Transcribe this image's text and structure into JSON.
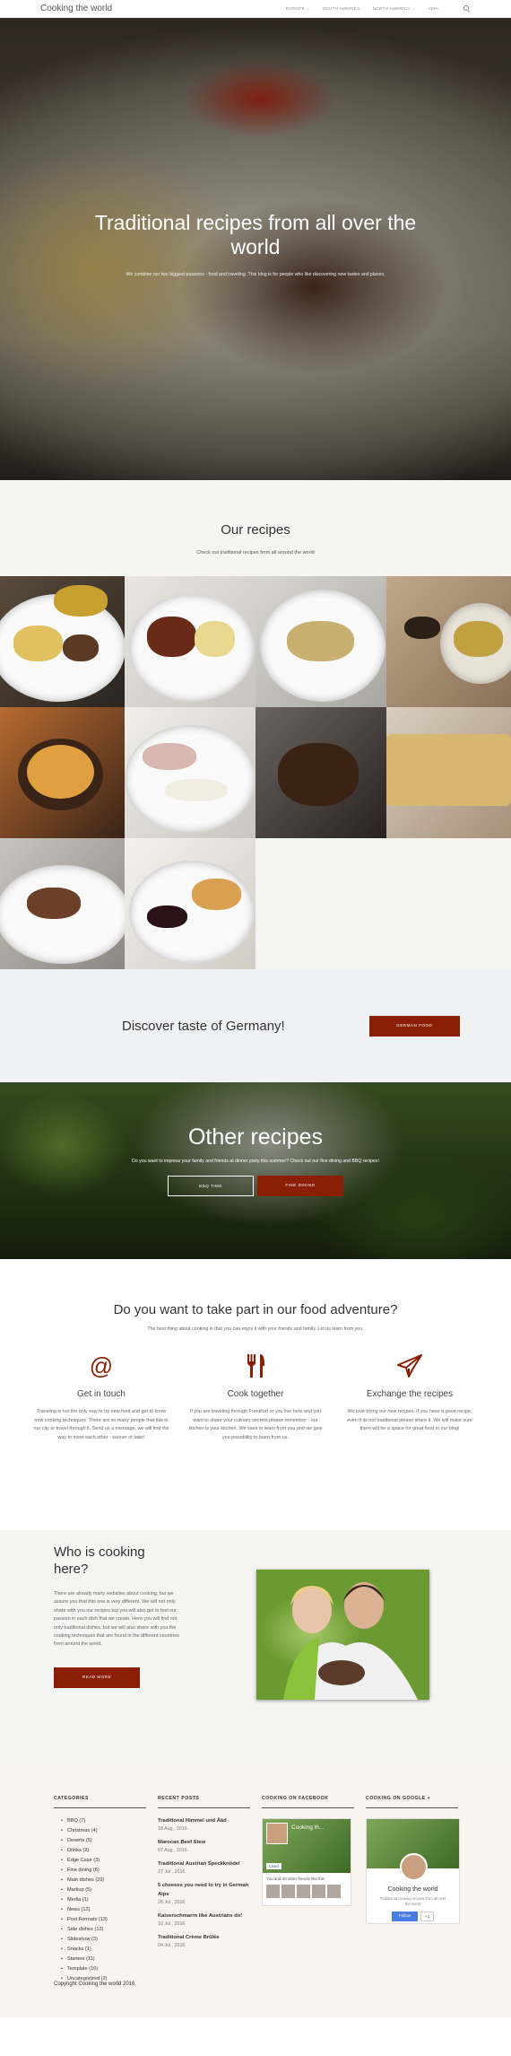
{
  "header": {
    "brand": "Cooking the world",
    "nav": [
      {
        "label": "EUROPE",
        "caret": "⌄"
      },
      {
        "label": "SOUTH AMERICA",
        "caret": ""
      },
      {
        "label": "NORTH AMERICA",
        "caret": "⌄"
      },
      {
        "label": "ASIA",
        "caret": ""
      }
    ]
  },
  "hero": {
    "title": "Traditional recipes from all over the world",
    "subtitle": "We combine our two biggest passions - food and traveling. This blog is for people who like discovering new tastes and places."
  },
  "recipes": {
    "title": "Our recipes",
    "subtitle": "Check out traditional recipes from all around the world"
  },
  "discover": {
    "title": "Discover taste of Germany!",
    "button": "GERMAN FOOD"
  },
  "other": {
    "title": "Other recipes",
    "subtitle": "Do you want to impress your family and friends at dinner party this summer? Check out our fine dining and BBQ recipes!",
    "btn_bbq": "BBQ TIME",
    "btn_fine": "FINE DINING"
  },
  "adventure": {
    "title": "Do you want to take part in our food adventure?",
    "subtitle": "The best thing about cooking is that you can enjoy it with your friends and family. Let us learn from you.",
    "features": [
      {
        "icon": "at-icon",
        "glyph": "@",
        "title": "Get in touch",
        "text": "Traveling is not the only way to try new food and get to know new cooking techniques. There are so many people that live in our city or travel through it. Send us a message, we will find the way to meet each other - sooner or later!"
      },
      {
        "icon": "cutlery-icon",
        "glyph": "🍴",
        "title": "Cook together",
        "text": "If you are traveling through Frankfurt or you live here and you want to share your culinary secrets please remember - our kitchen is your kitchen. We want to learn from you and we give you possibility to learn from us."
      },
      {
        "icon": "paper-plane-icon",
        "glyph": "✈",
        "title": "Exchange the recipes",
        "text": "We love trying our new recipes. If you have a great recipe, even if its not traditional please share it. We will make sure there will be a space for great food in our blog!"
      }
    ]
  },
  "who": {
    "title": "Who is cooking here?",
    "text": "There are already many websites about cooking, but we assure you that this one is very different. We will not only share with you our recipes but you will also get to feel our passion in each dish that we create. Here you will find not only traditional dishes, but we will also share with you the cooking techniques that are found in the different countries from around the world.",
    "button": "READ MORE"
  },
  "footer": {
    "categories_title": "CATEGORIES",
    "categories": [
      "BBQ (7)",
      "Christmas (4)",
      "Deserts (5)",
      "Drinks (2)",
      "Edge Case (3)",
      "Fine dining (6)",
      "Main dishes (29)",
      "Markup (5)",
      "Media (1)",
      "News (12)",
      "Post Formats (13)",
      "Side dishes (12)",
      "Slideshow (3)",
      "Snacks (1)",
      "Starters (11)",
      "Template (10)",
      "Uncategorized (2)"
    ],
    "posts_title": "RECENT POSTS",
    "posts": [
      {
        "title": "Traditional Himmel und Ääd",
        "date": "18 Aug , 2016"
      },
      {
        "title": "Marocan Beef Stew",
        "date": "07 Aug , 2016"
      },
      {
        "title": "Traditional Austrian Speckknödel",
        "date": "27 Jul , 2016"
      },
      {
        "title": "5 cheeses you need to try in German Alps",
        "date": "26 Jul , 2016"
      },
      {
        "title": "Kaiserschmarrn like Austrians do!",
        "date": "10 Jul , 2016"
      },
      {
        "title": "Traditional Crème Brûlée",
        "date": "04 Jul , 2016"
      }
    ],
    "facebook_title": "COOKING ON FACEBOOK",
    "facebook": {
      "page": "Cooking th...",
      "like": "Liked",
      "friends": "You and 40 other friends like this"
    },
    "google_title": "COOKING ON GOOGLE +",
    "google": {
      "name": "Cooking the world",
      "desc": "Traditional cooking recipes from all over the world",
      "follow": "Follow",
      "count": "+1"
    },
    "copyright": "Copyright Cooking the world 2016"
  },
  "colors": {
    "accent": "#8b1f05"
  }
}
